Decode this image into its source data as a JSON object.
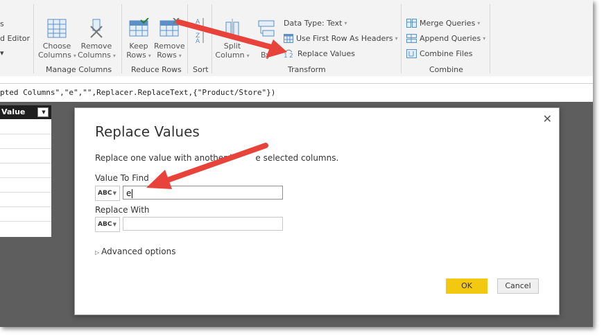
{
  "ribbon": {
    "left_partial_items": [
      "s",
      "d Editor"
    ],
    "manage_columns": {
      "label": "Manage Columns",
      "choose_columns": [
        "Choose",
        "Columns"
      ],
      "remove_columns": [
        "Remove",
        "Columns"
      ]
    },
    "reduce_rows": {
      "label": "Reduce Rows",
      "keep_rows": [
        "Keep",
        "Rows"
      ],
      "remove_rows": [
        "Remove",
        "Rows"
      ]
    },
    "sort": {
      "label": "Sort"
    },
    "transform": {
      "label": "Transform",
      "split_column": [
        "Split",
        "Column"
      ],
      "group_by_partial": "By",
      "data_type": "Data Type: Text",
      "first_row_headers": "Use First Row As Headers",
      "replace_values": "Replace Values"
    },
    "combine": {
      "label": "Combine",
      "merge_queries": "Merge Queries",
      "append_queries": "Append Queries",
      "combine_files": "Combine Files"
    }
  },
  "formula_bar": {
    "text": "pted Columns\",\"e\",\"\",Replacer.ReplaceText,{\"Product/Store\"})"
  },
  "table": {
    "column_header": "Value"
  },
  "dialog": {
    "title": "Replace Values",
    "description": "Replace one value with another in the selected columns.",
    "description_visible_a": "Replace one value with another i",
    "description_visible_b": "e selected columns.",
    "value_to_find_label": "Value To Find",
    "value_to_find": "e",
    "replace_with_label": "Replace With",
    "replace_with": "",
    "type_glyph": "ABC",
    "advanced_options": "Advanced options",
    "ok_label": "OK",
    "cancel_label": "Cancel",
    "close_glyph": "✕"
  },
  "colors": {
    "annotation_arrow": "#e8433b",
    "ok_button": "#f2c811",
    "workspace": "#5e5e5e",
    "ribbon": "#f3f3f3"
  }
}
